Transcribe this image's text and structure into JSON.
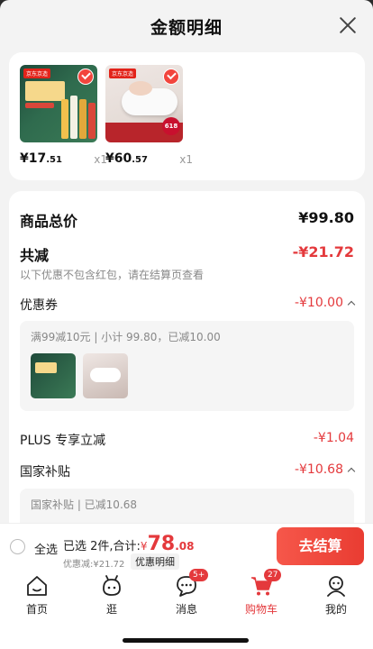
{
  "sheet": {
    "title": "金额明细"
  },
  "products": [
    {
      "price_int": "¥17",
      "price_dec": ".51",
      "qty": "x1",
      "tag": "京东京造"
    },
    {
      "price_int": "¥60",
      "price_dec": ".57",
      "qty": "x1",
      "tag": "京东京造",
      "badge": "618"
    }
  ],
  "details": {
    "total_label": "商品总价",
    "total_value": "¥99.80",
    "reduce_label": "共减",
    "reduce_value": "-¥21.72",
    "reduce_note": "以下优惠不包含红包，请在结算页查看",
    "coupon_label": "优惠券",
    "coupon_value": "-¥10.00",
    "coupon_detail": "满99减10元 | 小计 99.80，已减10.00",
    "plus_label": "PLUS 专享立减",
    "plus_value": "-¥1.04",
    "subsidy_label": "国家补贴",
    "subsidy_value": "-¥10.68",
    "subsidy_detail": "国家补贴 | 已减10.68"
  },
  "checkout": {
    "select_all": "全选",
    "summary_prefix": "已选 2件,合计:",
    "currency": "¥",
    "total_int": "78",
    "total_dec": ".08",
    "discount_text": "优惠减:¥21.72",
    "detail_link": "优惠明细",
    "button_label": "去结算"
  },
  "tabbar": [
    {
      "label": "首页",
      "icon": "home-icon"
    },
    {
      "label": "逛",
      "icon": "browse-icon"
    },
    {
      "label": "消息",
      "icon": "message-icon",
      "badge": "5+"
    },
    {
      "label": "购物车",
      "icon": "cart-icon",
      "badge": "27",
      "active": true
    },
    {
      "label": "我的",
      "icon": "profile-icon"
    }
  ],
  "colors": {
    "accent": "#e4393c",
    "text": "#1a1a1a",
    "muted": "#888888"
  }
}
